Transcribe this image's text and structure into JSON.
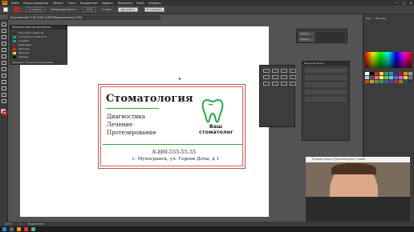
{
  "app": {
    "logo": "Ai",
    "menu": [
      "Файл",
      "Редактирование",
      "Объект",
      "Текст",
      "Выделение",
      "Эффект",
      "Просмотр",
      "Окно",
      "Справка"
    ],
    "window_controls": [
      "—",
      "□",
      "✕"
    ]
  },
  "control_bar": {
    "stroke_label": "Основная",
    "opacity_label": "Непрозрачность:",
    "opacity_value": "100%",
    "style_label": "Стиль:",
    "doc_setup": "Документ",
    "prefs": "Установки"
  },
  "document_tab": "Безымянный-1* @ 200% (CMYK/Предпросмотр GPU)",
  "swatch_panel": {
    "title": "Просмотр цветов документа",
    "items": [
      {
        "label": "Просмотр символов",
        "color": "#333333"
      },
      {
        "label": "C=75 M=0 Y=100 K=0",
        "color": "#2aa44a"
      },
      {
        "label": "Голубой",
        "color": "#00a0e6"
      },
      {
        "label": "Бордовый",
        "color": "#b01030"
      },
      {
        "label": "Красный",
        "color": "#e02020"
      },
      {
        "label": "Желтый",
        "color": "#f2e200"
      },
      {
        "label": "Черный",
        "color": "#111111"
      }
    ],
    "footer": "Показать только используемые"
  },
  "card": {
    "title": "Стоматология",
    "services": [
      "Диагностика",
      "Лечение",
      "Протезирование"
    ],
    "logo_lines": [
      "Ваш",
      "стоматолог"
    ],
    "phone": "8-800-555-55-55",
    "address": "г. Мухосранск, ул. Героев Доты, д 1",
    "accent": "#2aa44a",
    "bleed": "#e06060"
  },
  "layers_panel": {
    "rows": [
      "Слой 1",
      "Слой 2"
    ]
  },
  "right_panels": {
    "tabs": [
      "Цвет",
      "Образцы"
    ],
    "section": "Внешний облик"
  },
  "video": {
    "title": "Прямой эфир в (Рекомендуем): новый"
  },
  "statusbar": {
    "zoom": "200%",
    "page": "1",
    "tool": "Выделение"
  }
}
